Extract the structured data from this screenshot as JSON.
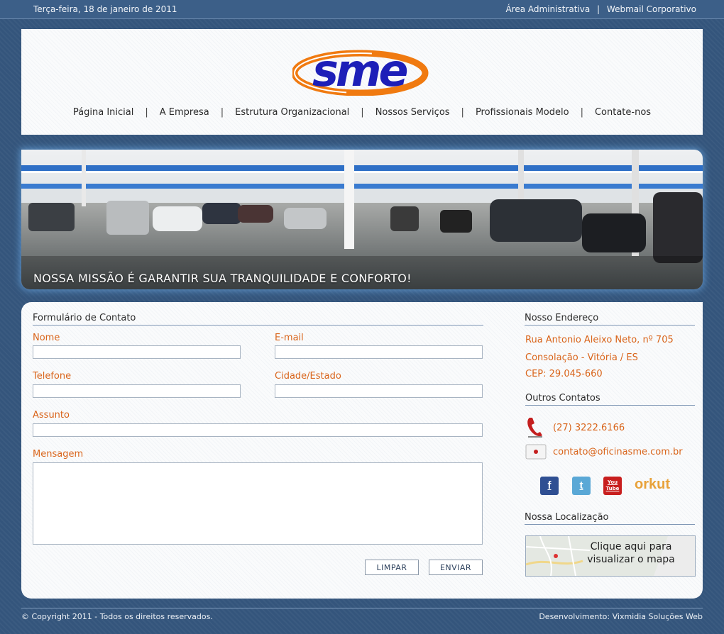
{
  "topbar": {
    "date": "Terça-feira, 18 de janeiro de 2011",
    "links": [
      "Área Administrativa",
      "Webmail Corporativo"
    ]
  },
  "logo": {
    "text": "sme"
  },
  "nav": {
    "items": [
      "Página Inicial",
      "A Empresa",
      "Estrutura Organizacional",
      "Nossos Serviços",
      "Profissionais Modelo",
      "Contate-nos"
    ]
  },
  "banner": {
    "caption": "NOSSA MISSÃO É GARANTIR SUA TRANQUILIDADE E CONFORTO!"
  },
  "form": {
    "title": "Formulário de Contato",
    "nome_label": "Nome",
    "email_label": "E-mail",
    "telefone_label": "Telefone",
    "cidade_label": "Cidade/Estado",
    "assunto_label": "Assunto",
    "mensagem_label": "Mensagem",
    "nome_value": "",
    "email_value": "",
    "telefone_value": "",
    "cidade_value": "",
    "assunto_value": "",
    "mensagem_value": "",
    "clear_label": "LIMPAR",
    "send_label": "ENVIAR"
  },
  "address": {
    "title": "Nosso Endereço",
    "line1": "Rua Antonio Aleixo Neto, nº 705",
    "line2": "Consolação - Vitória / ES",
    "line3": "CEP: 29.045-660"
  },
  "contacts": {
    "title": "Outros Contatos",
    "phone": "(27) 3222.6166",
    "email": "contato@oficinasme.com.br"
  },
  "social": {
    "facebook": "f",
    "twitter": "t",
    "youtube": "You Tube",
    "orkut": "orkut"
  },
  "location": {
    "title": "Nossa Localização",
    "map_line1": "Clique aqui para",
    "map_line2": "visualizar o mapa"
  },
  "footer": {
    "copyright": "© Copyright 2011 - Todos os direitos reservados.",
    "developer": "Desenvolvimento: Vixmidia Soluções Web"
  },
  "colors": {
    "background": "#34557c",
    "accent_orange": "#d9641a",
    "logo_blue": "#1d1fb8",
    "logo_orange": "#f07a10"
  }
}
